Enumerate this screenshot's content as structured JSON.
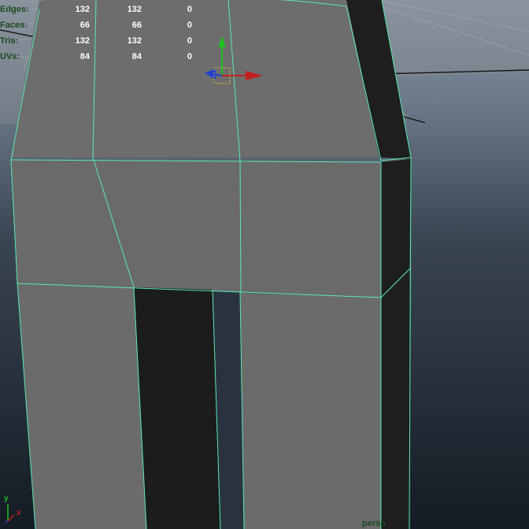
{
  "hud": {
    "rows": [
      {
        "label": "Edges:",
        "v1": "132",
        "v2": "132",
        "v3": "0"
      },
      {
        "label": "Faces:",
        "v1": "66",
        "v2": "66",
        "v3": "0"
      },
      {
        "label": "Tris:",
        "v1": "132",
        "v2": "132",
        "v3": "0"
      },
      {
        "label": "UVs:",
        "v1": "84",
        "v2": "84",
        "v3": "0"
      }
    ]
  },
  "camera": {
    "label": "persp"
  },
  "axis": {
    "x": "x",
    "y": "y"
  },
  "colors": {
    "wireframe": "#5be8b4",
    "mesh_face": "#6c6c6c",
    "mesh_dark": "#1e1e1e",
    "hud_label": "#1b4a1f",
    "hud_value": "#ffffff",
    "manip_x": "#c02020",
    "manip_y": "#20c020",
    "manip_z": "#2040d0",
    "pivot": "#e8c020"
  }
}
